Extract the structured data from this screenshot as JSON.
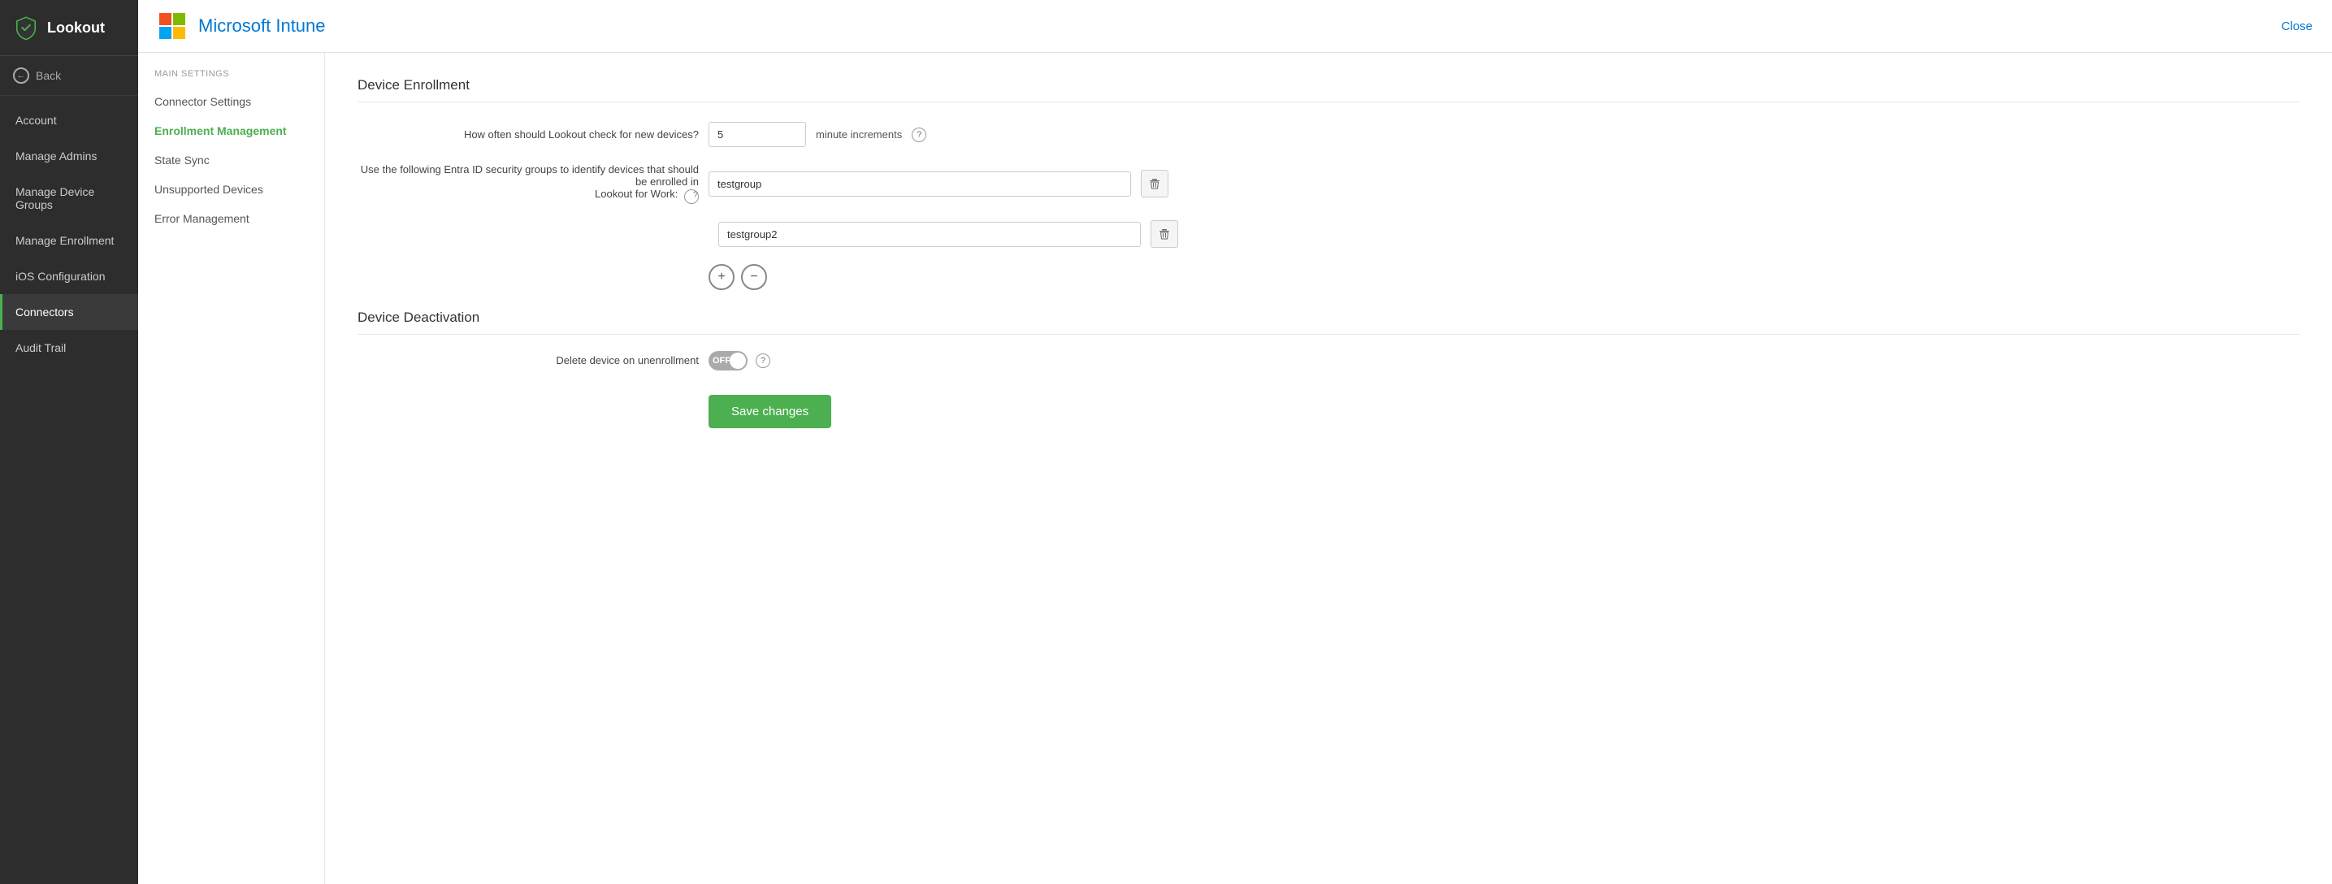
{
  "sidebar": {
    "logo_text": "Lookout",
    "back_label": "Back",
    "items": [
      {
        "id": "account",
        "label": "Account",
        "active": false
      },
      {
        "id": "manage-admins",
        "label": "Manage Admins",
        "active": false
      },
      {
        "id": "manage-device-groups",
        "label": "Manage Device Groups",
        "active": false
      },
      {
        "id": "manage-enrollment",
        "label": "Manage Enrollment",
        "active": false
      },
      {
        "id": "ios-configuration",
        "label": "iOS Configuration",
        "active": false
      },
      {
        "id": "connectors",
        "label": "Connectors",
        "active": true
      },
      {
        "id": "audit-trail",
        "label": "Audit Trail",
        "active": false
      }
    ]
  },
  "header": {
    "title": "Microsoft Intune",
    "close_label": "Close"
  },
  "left_nav": {
    "section_label": "MAIN SETTINGS",
    "items": [
      {
        "id": "connector-settings",
        "label": "Connector Settings",
        "active": false
      },
      {
        "id": "enrollment-management",
        "label": "Enrollment Management",
        "active": true
      },
      {
        "id": "state-sync",
        "label": "State Sync",
        "active": false
      },
      {
        "id": "unsupported-devices",
        "label": "Unsupported Devices",
        "active": false
      },
      {
        "id": "error-management",
        "label": "Error Management",
        "active": false
      }
    ]
  },
  "enrollment": {
    "section1_title": "Device Enrollment",
    "frequency_label": "How often should Lookout check for new devices?",
    "frequency_value": "5",
    "frequency_unit": "minute increments",
    "groups_label": "Use the following Entra ID security groups to identify devices that should be enrolled in Lookout for Work:",
    "groups": [
      {
        "value": "testgroup"
      },
      {
        "value": "testgroup2"
      }
    ],
    "add_btn_symbol": "+",
    "remove_btn_symbol": "−",
    "section2_title": "Device Deactivation",
    "delete_label": "Delete device on unenrollment",
    "toggle_state": "OFF",
    "save_label": "Save changes"
  }
}
